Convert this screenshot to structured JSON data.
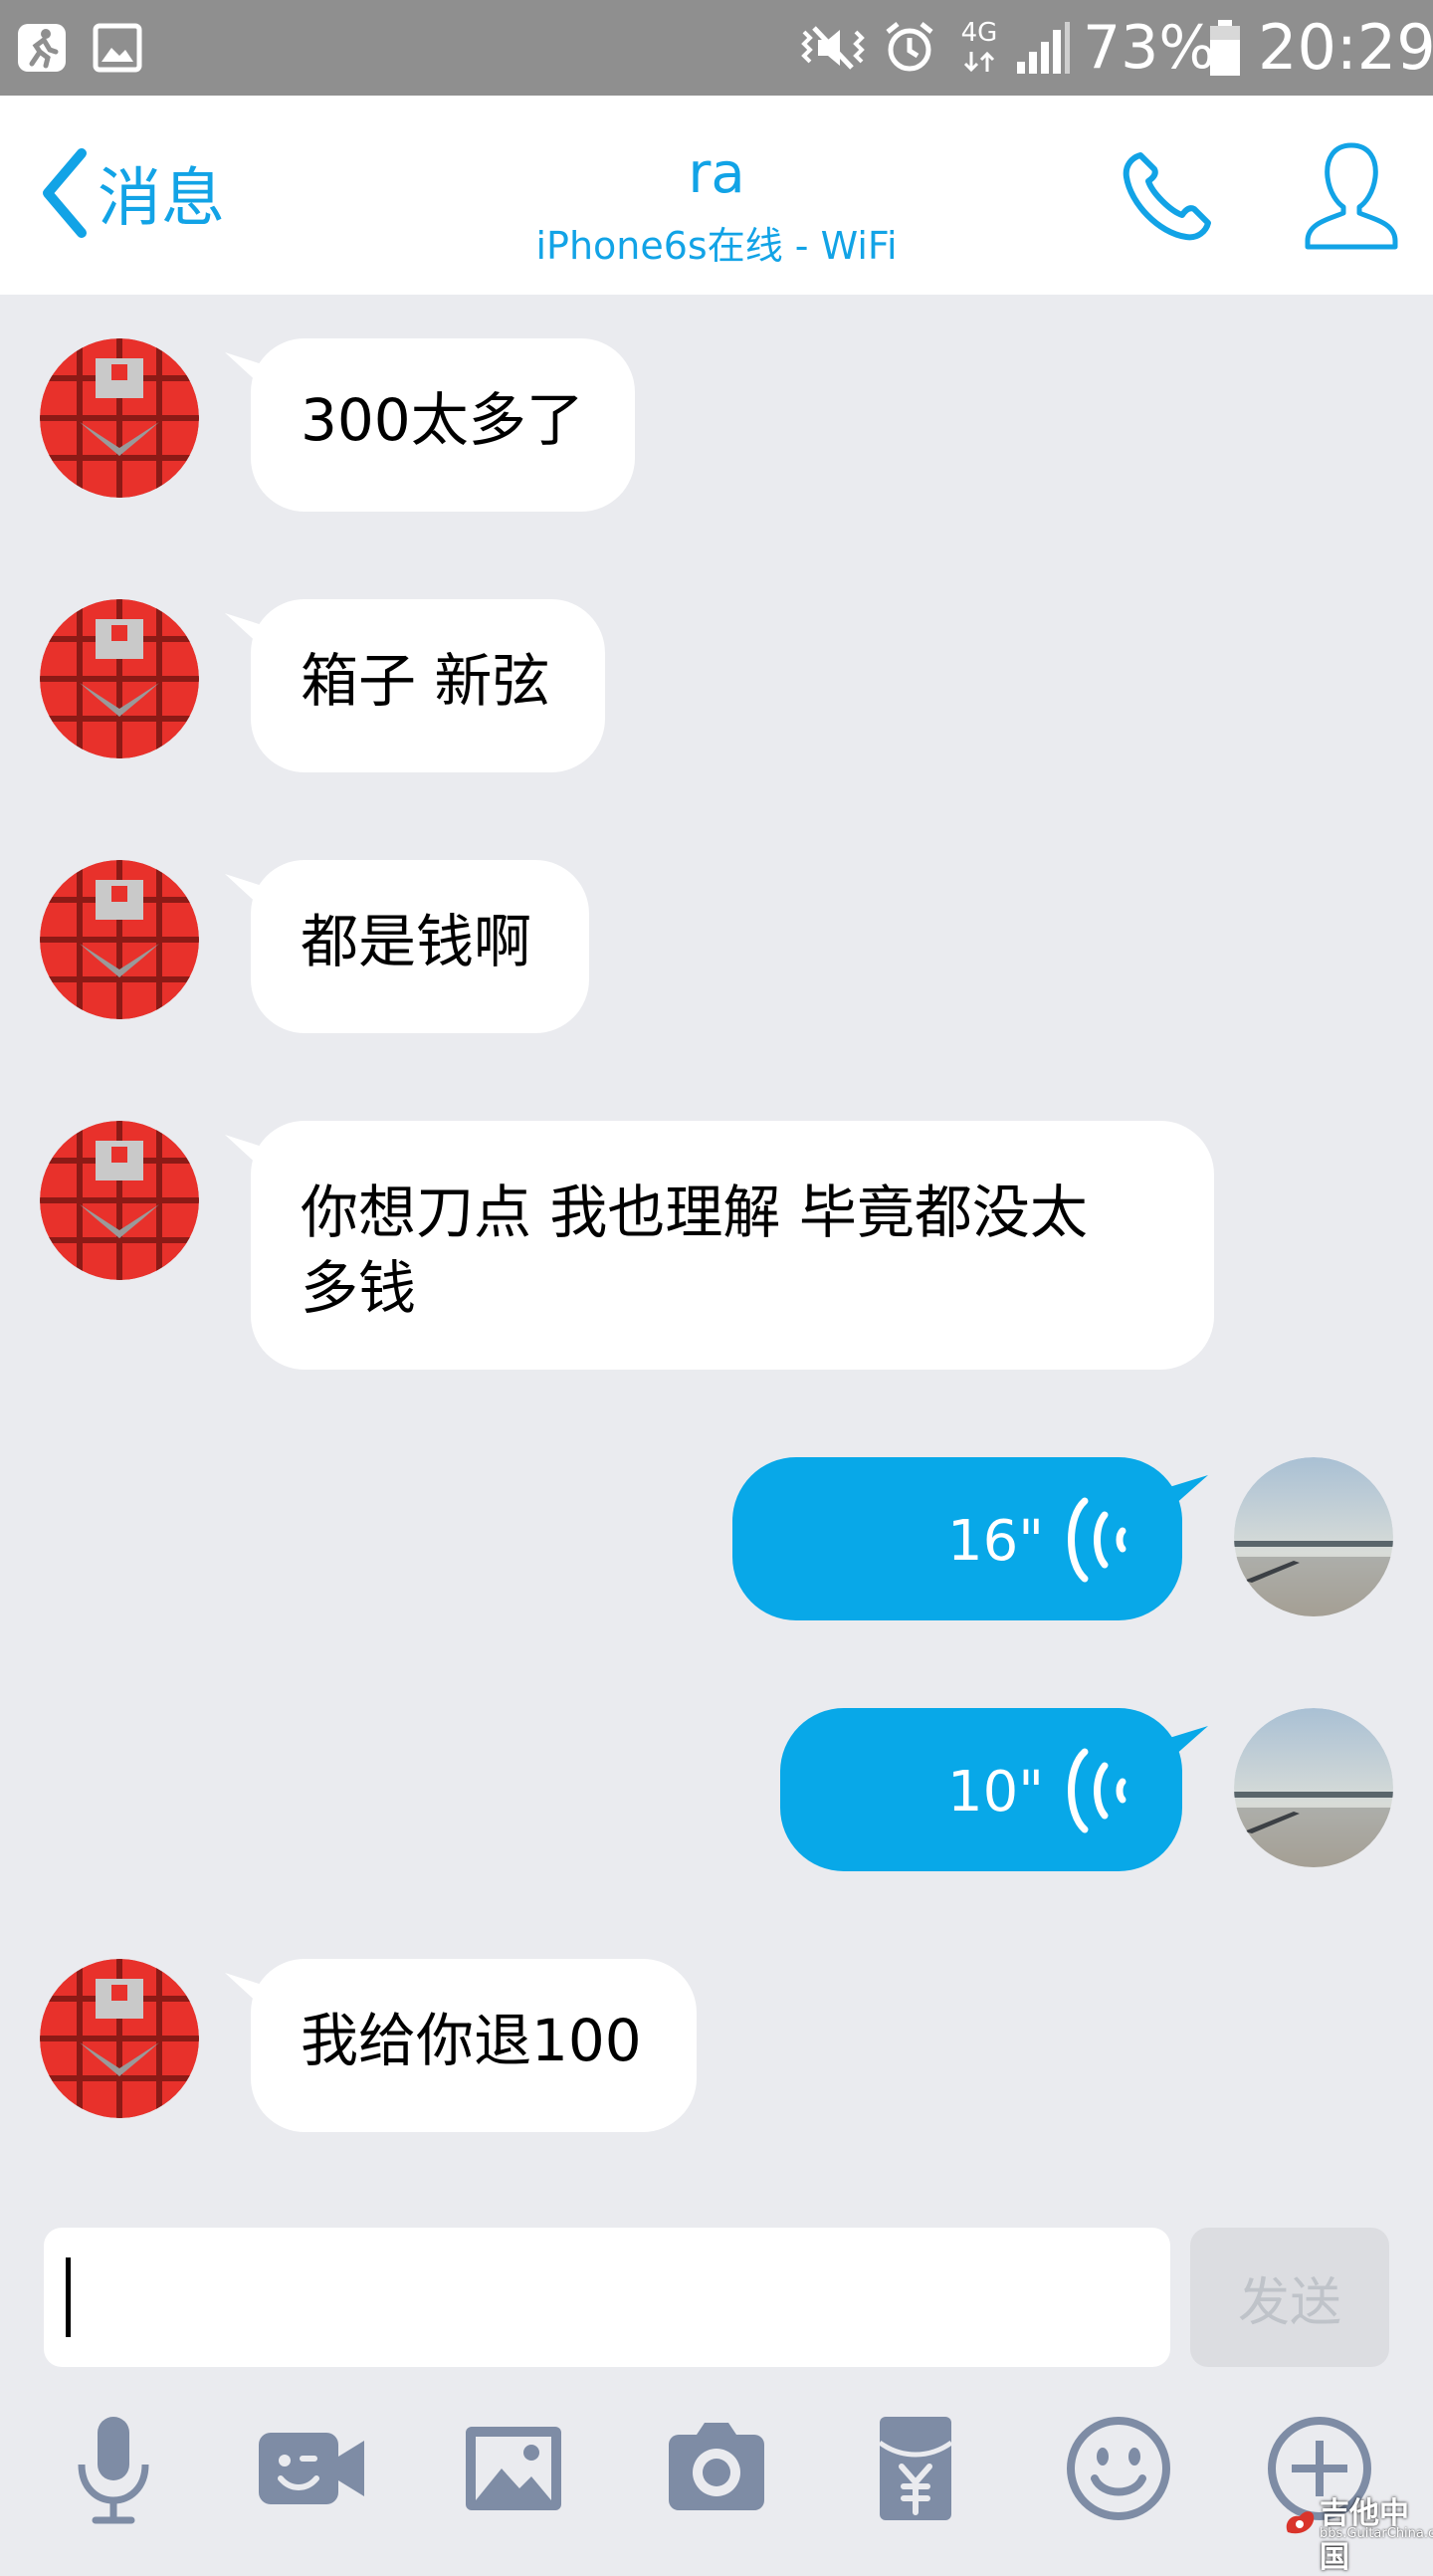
{
  "status_bar": {
    "battery_percent": "73%",
    "time": "20:29",
    "network": "4G"
  },
  "header": {
    "back_label": "消息",
    "contact_name": "ra",
    "contact_status": "iPhone6s在线 - WiFi"
  },
  "messages": [
    {
      "direction": "in",
      "text": "300太多了"
    },
    {
      "direction": "in",
      "text": "箱子 新弦"
    },
    {
      "direction": "in",
      "text": "都是钱啊"
    },
    {
      "direction": "in",
      "text": "你想刀点 我也理解 毕竟都没太多钱"
    },
    {
      "direction": "out",
      "type": "voice",
      "duration": "16\""
    },
    {
      "direction": "out",
      "type": "voice",
      "duration": "10\""
    },
    {
      "direction": "in",
      "text": "我给你退100"
    }
  ],
  "input": {
    "value": "",
    "send_label": "发送"
  },
  "toolbar": {
    "icons": [
      "microphone-icon",
      "video-call-icon",
      "image-icon",
      "camera-icon",
      "red-packet-icon",
      "emoji-icon",
      "plus-icon"
    ]
  },
  "colors": {
    "accent": "#12a3e6",
    "outgoing_bubble": "#08a8e8",
    "background": "#eaebef",
    "status_bar": "#8f8f8f"
  },
  "watermark": {
    "text": "吉他中国",
    "subtext": "bbs.GuitarChina.com"
  }
}
